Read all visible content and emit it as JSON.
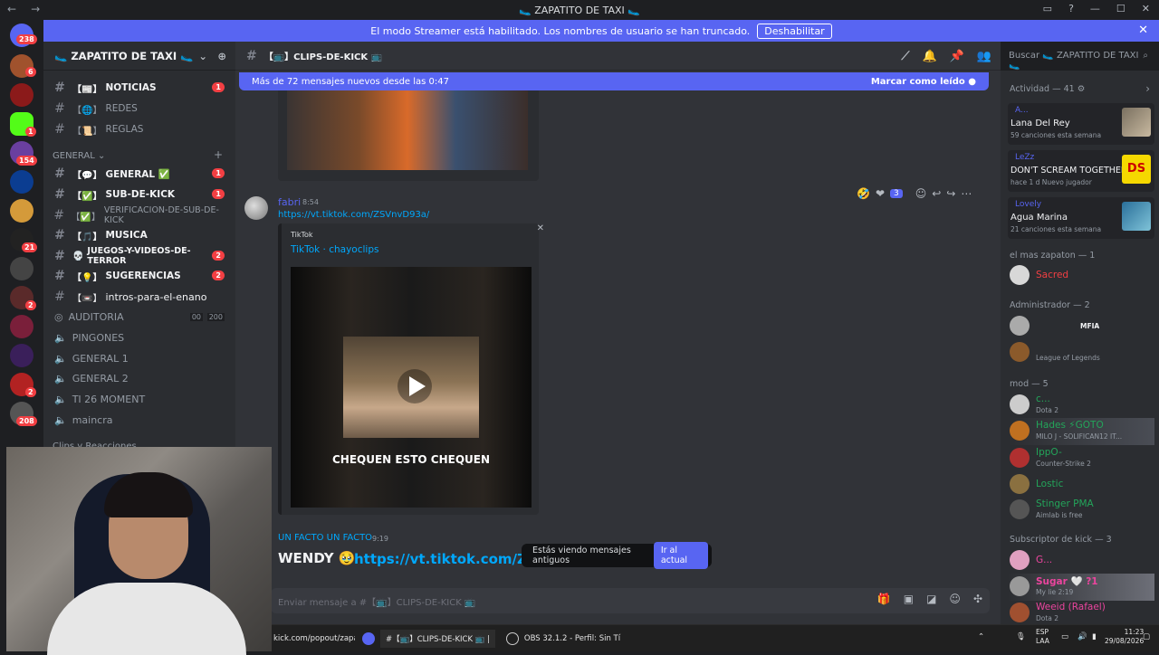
{
  "window": {
    "title": "🥿 ZAPATITO DE TAXI 🥿",
    "nav_back": "←",
    "nav_forward": "→",
    "controls": [
      "▭",
      "?",
      "—",
      "☐",
      "✕"
    ]
  },
  "banner": {
    "text": "El modo Streamer está habilitado. Los nombres de usuario se han truncado.",
    "button": "Deshabilitar",
    "close": "✕"
  },
  "rail": {
    "badges": [
      "238",
      "6",
      "1",
      "154",
      "21",
      "2",
      "2",
      "208"
    ]
  },
  "sidebar": {
    "server_name": "🥿 ZAPATITO DE TAXI 🥿",
    "channels_top": [
      {
        "emoji": "【📰】",
        "name": "NOTICIAS",
        "unread": true,
        "count": "1"
      },
      {
        "emoji": "【🌐】",
        "name": "REDES",
        "unread": false,
        "count": ""
      },
      {
        "emoji": "【📜】",
        "name": "REGLAS",
        "unread": false,
        "count": ""
      }
    ],
    "category_general": "GENERAL",
    "channels_general": [
      {
        "emoji": "【💬】",
        "name": "GENERAL ✅",
        "unread": true,
        "count": "1"
      },
      {
        "emoji": "【✅】",
        "name": "SUB-DE-KICK",
        "unread": true,
        "count": "1"
      },
      {
        "emoji": "【✅】",
        "name": "VERIFICACION-DE-SUB-DE-KICK",
        "unread": false,
        "count": ""
      },
      {
        "emoji": "【🎵】",
        "name": "MUSICA",
        "unread": true,
        "count": ""
      },
      {
        "emoji": "💀",
        "name": "JUEGOS-Y-VIDEOS-DE-TERROR",
        "unread": true,
        "count": "2"
      },
      {
        "emoji": "【💡】",
        "name": "SUGERENCIAS",
        "unread": true,
        "count": "2"
      },
      {
        "emoji": "【📼】",
        "name": "intros-para-el-enano",
        "unread": true,
        "count": ""
      }
    ],
    "voice": [
      {
        "name": "AUDITORIA",
        "extra1": "00",
        "extra2": "200"
      },
      {
        "name": "PINGONES"
      },
      {
        "name": "GENERAL 1"
      },
      {
        "name": "GENERAL 2"
      },
      {
        "name": "TI 26 MOMENT"
      },
      {
        "name": "maincra"
      }
    ],
    "category_clips": "Clips y Reacciones"
  },
  "chat": {
    "channel": "【📺】CLIPS-DE-KICK 📺",
    "search_placeholder": "Buscar 🥿 ZAPATITO DE TAXI 🥿",
    "new_messages": "Más de 72 mensajes nuevos desde las 0:47",
    "mark_read": "Marcar como leído",
    "messages": [
      {
        "author": "fabri",
        "time": "8:54",
        "link": "https://vt.tiktok.com/ZSVnvD93a/",
        "embed_provider": "TikTok",
        "embed_title": "TikTok · chayoclips",
        "video_caption": "CHEQUEN ESTO CHEQUEN",
        "reaction_count": "3"
      },
      {
        "author": "UN FACTO UN FACTO",
        "time": "9:19",
        "text": "WENDY 🥹",
        "link": "https://vt.tiktok.com/ZSV"
      }
    ],
    "toast_text": "Estás viendo mensajes antiguos",
    "toast_button": "Ir al actual",
    "composer_placeholder": "Enviar mensaje a #【📺】CLIPS-DE-KICK 📺"
  },
  "members": {
    "activity_header": "Actividad — 41",
    "activities": [
      {
        "user": "A...",
        "title": "Lana Del Rey",
        "sub": "59 canciones esta semana"
      },
      {
        "user": "LeZz",
        "title": "DON'T SCREAM TOGETHER",
        "sub": "hace 1 d   Nuevo jugador",
        "cover": "DS"
      },
      {
        "user": "Lovely",
        "title": "Agua Marina",
        "sub": "21 canciones esta semana"
      }
    ],
    "groups": [
      {
        "header": "el mas zapaton — 1",
        "members": [
          {
            "name": "Sacred",
            "status": "",
            "color": "#f23f43"
          }
        ]
      },
      {
        "header": "Administrador — 2",
        "members": [
          {
            "name": "",
            "status": "MFIA",
            "color": "#3b2ec7"
          },
          {
            "name": "",
            "status": "League of Legends",
            "color": "#3b2ec7"
          }
        ]
      },
      {
        "header": "mod — 5",
        "members": [
          {
            "name": "c...",
            "status": "Dota 2",
            "color": "#23a55a"
          },
          {
            "name": "Hades ⚡GOTO",
            "status": "MILO J - SOLIFICAN12 IT...",
            "color": "#23a55a"
          },
          {
            "name": "IppO-",
            "status": "Counter-Strike 2",
            "color": "#23a55a"
          },
          {
            "name": "Lostic",
            "status": "",
            "color": "#23a55a"
          },
          {
            "name": "Stinger PMA",
            "status": "Aimlab is free",
            "color": "#23a55a"
          }
        ]
      },
      {
        "header": "Subscriptor de kick — 3",
        "members": [
          {
            "name": "G...",
            "status": "",
            "color": "#eb459e"
          },
          {
            "name": "Sugar 🤍 ?1",
            "status": "My lie 2:19",
            "color": "#eb459e"
          },
          {
            "name": "Weeid (Rafael)",
            "status": "Dota 2",
            "color": "#eb459e"
          }
        ]
      }
    ]
  },
  "taskbar": {
    "url": "kick.com/popout/zapati",
    "discord": "#【📺】CLIPS-DE-KICK 📺 |",
    "obs": "OBS 32.1.2 - Perfil: Sin Tí",
    "lang": "ESP",
    "lang2": "LAA",
    "time": "11:23",
    "date": "29/08/2026"
  },
  "colors": {
    "accent": "#5865f2",
    "link": "#00a8fc",
    "danger": "#f23f43"
  }
}
